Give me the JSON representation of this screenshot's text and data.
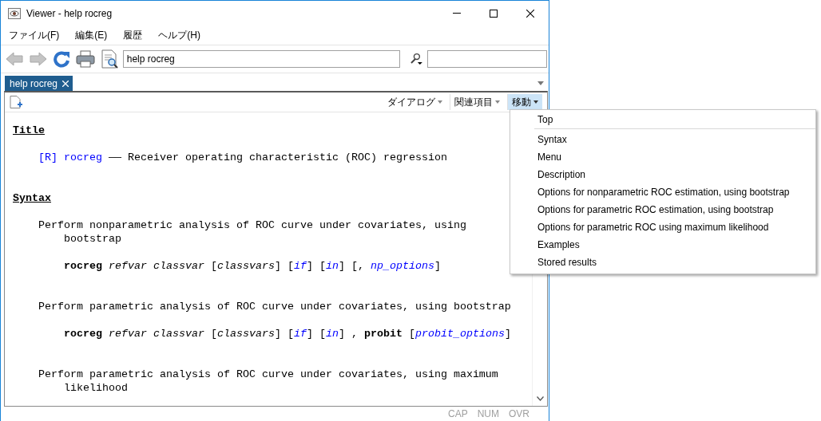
{
  "window": {
    "title": "Viewer - help rocreg"
  },
  "menu_bar": [
    {
      "label": "ファイル(F)"
    },
    {
      "label": "編集(E)"
    },
    {
      "label": "履歴"
    },
    {
      "label": "ヘルプ(H)"
    }
  ],
  "toolbar": {
    "back_disabled": true,
    "forward_disabled": true,
    "address": "help rocreg"
  },
  "tabs": [
    {
      "label": "help rocreg",
      "selected": true
    }
  ],
  "viewer_toolbar": [
    {
      "label": "ダイアログ",
      "pressed": false
    },
    {
      "label": "関連項目",
      "pressed": false
    },
    {
      "label": "移動",
      "pressed": true
    }
  ],
  "help": [
    {
      "kind": "heading",
      "text": "Title"
    },
    {
      "kind": "title",
      "segments": [
        {
          "kind": "link",
          "text": "[R]"
        },
        {
          "kind": "link",
          "text": "rocreg"
        },
        {
          "kind": "text",
          "text": "—— Receiver operating characteristic (ROC) regression"
        }
      ]
    },
    {
      "kind": "heading",
      "text": "Syntax"
    },
    {
      "kind": "para",
      "text": "Perform nonparametric analysis of ROC curve under covariates, using bootstrap"
    },
    {
      "kind": "syntax",
      "segments": [
        {
          "kind": "cmd",
          "text": "rocreg"
        },
        {
          "kind": "arg",
          "text": "refvar"
        },
        {
          "kind": "arg",
          "text": "classvar"
        },
        {
          "kind": "text",
          "text": "["
        },
        {
          "kind": "arg",
          "text": "classvars"
        },
        {
          "kind": "text",
          "text": "] ["
        },
        {
          "kind": "link-arg",
          "text": "if"
        },
        {
          "kind": "text",
          "text": "] ["
        },
        {
          "kind": "link-arg",
          "text": "in"
        },
        {
          "kind": "text",
          "text": "] [,"
        },
        {
          "kind": "link-arg",
          "text": "np_options"
        },
        {
          "kind": "text",
          "text": "]"
        }
      ]
    },
    {
      "kind": "para",
      "text": "Perform parametric analysis of ROC curve under covariates, using bootstrap"
    },
    {
      "kind": "syntax",
      "segments": [
        {
          "kind": "cmd",
          "text": "rocreg"
        },
        {
          "kind": "arg",
          "text": "refvar"
        },
        {
          "kind": "arg",
          "text": "classvar"
        },
        {
          "kind": "text",
          "text": "["
        },
        {
          "kind": "arg",
          "text": "classvars"
        },
        {
          "kind": "text",
          "text": "] ["
        },
        {
          "kind": "link-arg",
          "text": "if"
        },
        {
          "kind": "text",
          "text": "] ["
        },
        {
          "kind": "link-arg",
          "text": "in"
        },
        {
          "kind": "text",
          "text": "] ,"
        },
        {
          "kind": "cmd",
          "text": "probit"
        },
        {
          "kind": "text",
          "text": "["
        },
        {
          "kind": "link-arg",
          "text": "probit_options"
        },
        {
          "kind": "text",
          "text": "]"
        }
      ]
    },
    {
      "kind": "para",
      "text": "Perform parametric analysis of ROC curve under covariates, using maximum likelihood"
    }
  ],
  "jump_menu": [
    {
      "label": "Top",
      "divider_after": true
    },
    {
      "label": "Syntax",
      "divider_after": false
    },
    {
      "label": "Menu",
      "divider_after": false
    },
    {
      "label": "Description",
      "divider_after": false
    },
    {
      "label": "Options for nonparametric ROC estimation, using bootstrap",
      "divider_after": false
    },
    {
      "label": "Options for parametric ROC estimation, using bootstrap",
      "divider_after": false
    },
    {
      "label": "Options for parametric ROC using maximum likelihood",
      "divider_after": false
    },
    {
      "label": "Examples",
      "divider_after": false
    },
    {
      "label": "Stored results",
      "divider_after": false
    }
  ],
  "status_bar": [
    {
      "label": "CAP",
      "on": false
    },
    {
      "label": "NUM",
      "on": false
    },
    {
      "label": "OVR",
      "on": false
    }
  ]
}
